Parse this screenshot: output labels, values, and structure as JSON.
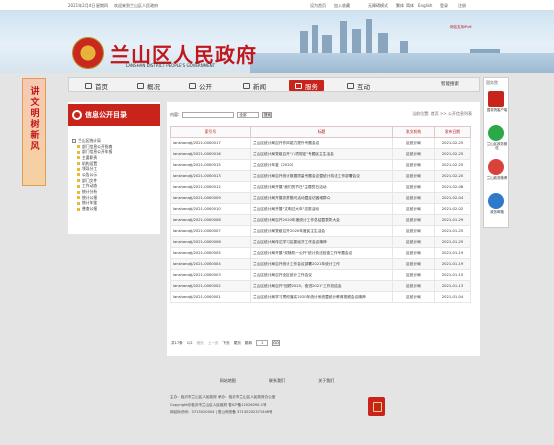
{
  "topbar": {
    "date": "2021年2月4日",
    "weekday": "星期四",
    "welcome": "欢迎来到兰山区人民政府",
    "links": [
      "设为首页",
      "加入收藏",
      "无障碍模式",
      "繁体",
      "简体",
      "English",
      "登录",
      "注册"
    ]
  },
  "banner": {
    "title": "兰山区人民政府",
    "subtitle": "LANSHAN DISTRICT PEOPLE'S GOVERNMENT",
    "right_link": "网站支持IPv6"
  },
  "nav": {
    "items": [
      {
        "label": "首页",
        "active": false
      },
      {
        "label": "概况",
        "active": false
      },
      {
        "label": "公开",
        "active": false
      },
      {
        "label": "新闻",
        "active": false
      },
      {
        "label": "服务",
        "active": true
      },
      {
        "label": "互动",
        "active": false
      }
    ],
    "search_label": "智能搜索"
  },
  "float_left": {
    "text": "讲文明树新风"
  },
  "sidebar": {
    "title": "信息公开目录",
    "tree": [
      {
        "label": "兰山区统计局",
        "child": false
      },
      {
        "label": "部门信息公开指南",
        "child": true
      },
      {
        "label": "部门信息公开年报",
        "child": true
      },
      {
        "label": "主要职责",
        "child": true
      },
      {
        "label": "机构设置",
        "child": true
      },
      {
        "label": "领导分工",
        "child": true
      },
      {
        "label": "公告公示",
        "child": true
      },
      {
        "label": "部门文件",
        "child": true
      },
      {
        "label": "工作动态",
        "child": true
      },
      {
        "label": "统计分析",
        "child": true
      },
      {
        "label": "统计公报",
        "child": true
      },
      {
        "label": "统计年鉴",
        "child": true
      },
      {
        "label": "普查公报",
        "child": true
      }
    ]
  },
  "right_panel": {
    "header": "国务院",
    "items": [
      {
        "label": "国务院客户端",
        "color": "#c8241c"
      },
      {
        "label": "兰山区政务微信",
        "color": "#2aa84a"
      },
      {
        "label": "兰山政务微博",
        "color": "#d9413a"
      },
      {
        "label": "政务邮箱",
        "color": "#2f79c8"
      }
    ]
  },
  "main": {
    "breadcrumb": "当前位置: 首页 >> 公开信息列表",
    "search": {
      "label": "内容:",
      "placeholder": "",
      "scope": "全部",
      "button": "搜索"
    },
    "columns": [
      "索引号",
      "标题",
      "发文机构",
      "发布日期"
    ],
    "rows": [
      [
        "lanshanqtj/2021-0000017",
        "兰山区统计局召开作风能力提升专题会议",
        "区统计局",
        "2021-02-25"
      ],
      [
        "lanshanqtj/2021-0000016",
        "兰山区统计局党组召开\"八项规定\"专题民主生活会",
        "区统计局",
        "2021-02-25"
      ],
      [
        "lanshanqtj/2021-0000015",
        "兰山区统计年鉴（2020）",
        "区统计局",
        "2021-02-25"
      ],
      [
        "lanshanqtj/2021-0000013",
        "兰山区统计局召开统计数据质量专题会议暨统计执法工作部署会议",
        "区统计局",
        "2021-02-20"
      ],
      [
        "lanshanqtj/2021-0000012",
        "兰山区统计局开展\"我们的节日\"主题党日活动",
        "区统计局",
        "2021-02-08"
      ],
      [
        "lanshanqtj/2021-0000009",
        "兰山区统计局开展扶贫慰问活动暨走访困难群众",
        "区统计局",
        "2021-02-04"
      ],
      [
        "lanshanqtj/2021-0000010",
        "兰山区统计局开展\"文明过大年\"志愿活动",
        "区统计局",
        "2021-02-02"
      ],
      [
        "lanshanqtj/2021-0000008",
        "兰山区统计局召开2020年度统计工作总结暨表彰大会",
        "区统计局",
        "2021-01-29"
      ],
      [
        "lanshanqtj/2021-0000007",
        "兰山区统计局党组召开2020年度民主生活会",
        "区统计局",
        "2021-01-25"
      ],
      [
        "lanshanqtj/2021-0000006",
        "兰山区统计局传达学习区委经济工作会议精神",
        "区统计局",
        "2021-01-25"
      ],
      [
        "lanshanqtj/2021-0000005",
        "兰山区统计局开展\"双随机一公开\"统计执法检查工作专题会议",
        "区统计局",
        "2021-01-19"
      ],
      [
        "lanshanqtj/2021-0000004",
        "兰山区统计局召开统计工作会议部署2021年统计工作",
        "区统计局",
        "2021-01-19"
      ],
      [
        "lanshanqtj/2021-0000003",
        "兰山区统计局召开全区统计工作会议",
        "区统计局",
        "2021-01-15"
      ],
      [
        "lanshanqtj/2021-0000002",
        "兰山区统计局召开\"回顾2020，奋进2021\"工作总结会",
        "区统计局",
        "2021-01-13"
      ],
      [
        "lanshanqtj/2021-0000001",
        "兰山区统计局学习贯彻落实2020年统计系统暨统计教育视频会议精神",
        "区统计局",
        "2021-01-04"
      ]
    ],
    "pager": {
      "total": "共17条",
      "pages": "1/2",
      "first": "首页",
      "prev": "上一页",
      "next": "下页",
      "last": "尾页",
      "goto_label": "跳转",
      "page_value": "1",
      "go": "GO"
    }
  },
  "footer": {
    "links": [
      "网站地图",
      "联系我们",
      "关于我们"
    ],
    "info": [
      "主办：临沂市兰山区人民政府  承办：临沂市兰山区人民政府办公室",
      "Copyright@临沂市兰山区人民政府  鲁ICP备12026095-1号",
      "网站标识码：3713020004  |  鲁公网安备 37130202371546号"
    ]
  }
}
